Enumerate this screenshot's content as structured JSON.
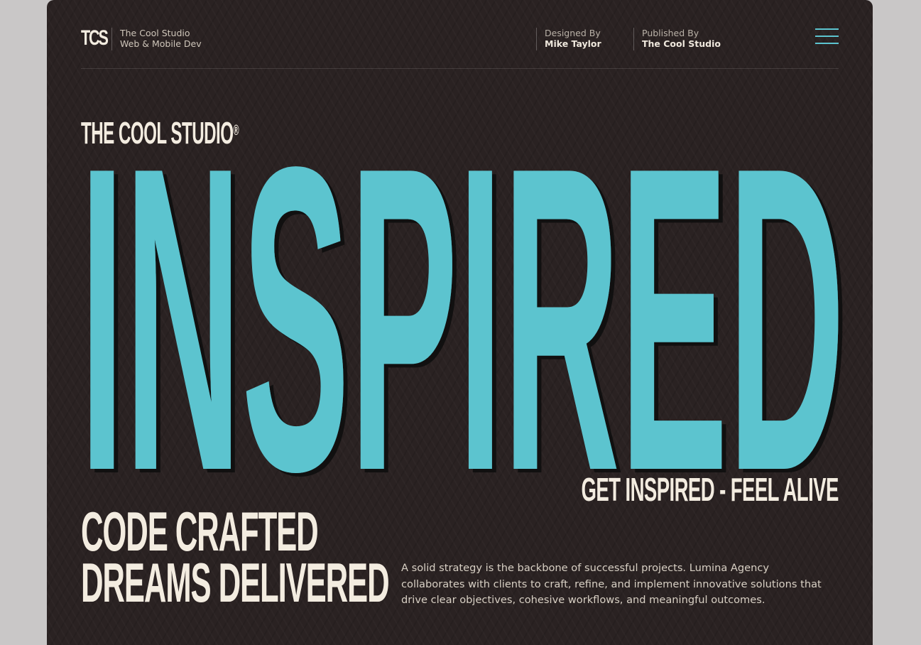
{
  "header": {
    "logo": "TCS",
    "studio_name": "The Cool Studio",
    "studio_tagline": "Web & Mobile Dev",
    "designed_label": "Designed By",
    "designed_value": "Mike Taylor",
    "published_label": "Published By",
    "published_value": "The Cool Studio"
  },
  "hero": {
    "brand": "THE COOL STUDIO",
    "brand_mark": "®",
    "big_word": "INSPIRED",
    "tagline": "GET INSPIRED - FEEL ALIVE",
    "headline_line1": "CODE CRAFTED",
    "headline_line2": "DREAMS DELIVERED",
    "description": "A solid strategy is the backbone of successful projects. Lumina Agency collaborates with clients to craft, refine, and implement innovative solutions that drive clear objectives, cohesive workflows, and meaningful outcomes."
  },
  "colors": {
    "background": "#2a2222",
    "accent": "#5cc4cf",
    "cream": "#f3ece0"
  },
  "icons": {
    "menu": "hamburger-menu-icon"
  }
}
